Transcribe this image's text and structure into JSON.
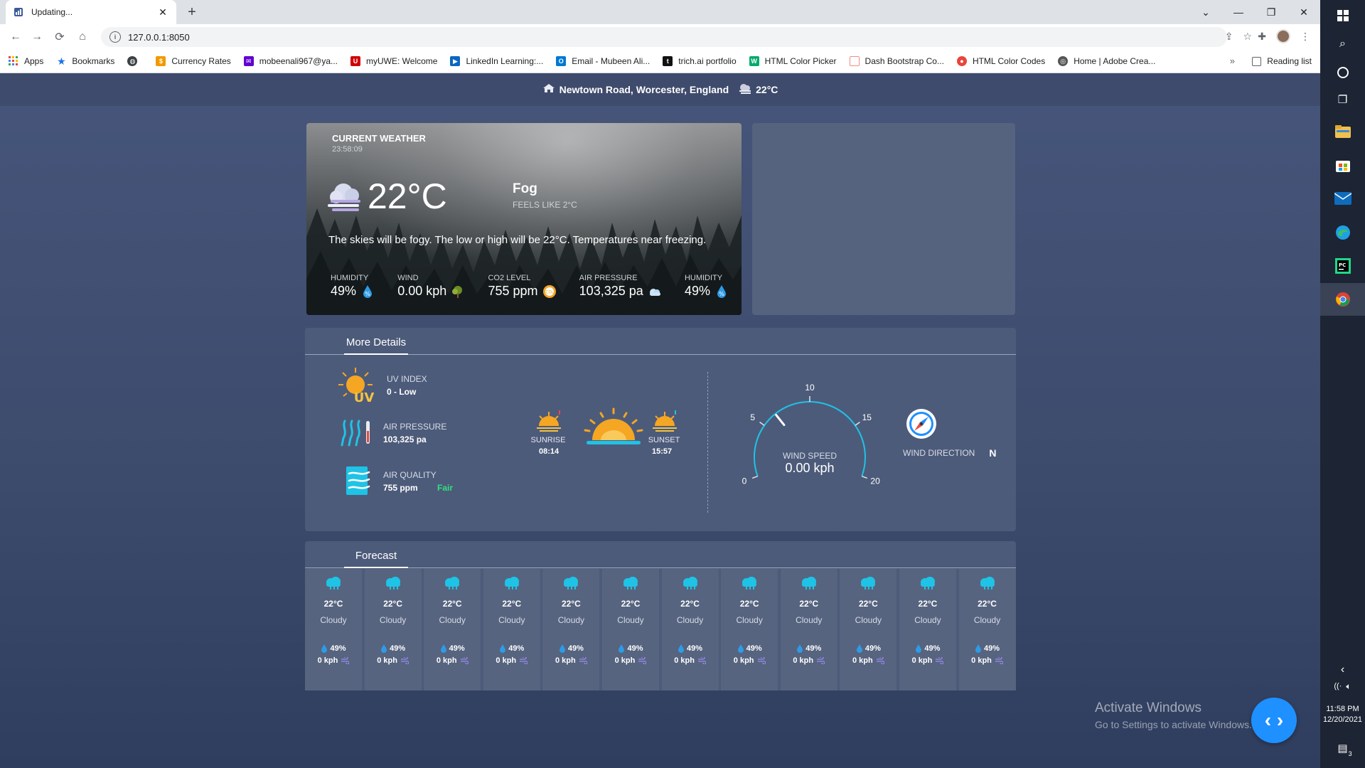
{
  "browser": {
    "tab_title": "Updating...",
    "url": "127.0.0.1:8050",
    "bookmarks": [
      {
        "label": "Apps",
        "icon": "apps-grid-icon",
        "color": "#e8453c"
      },
      {
        "label": "Bookmarks",
        "icon": "star-icon",
        "color": "#1a73e8"
      },
      {
        "label": "",
        "icon": "globe-icon",
        "color": "#3c4043"
      },
      {
        "label": "Currency Rates",
        "icon": "currency-icon",
        "color": "#f29900"
      },
      {
        "label": "mobeenali967@ya...",
        "icon": "mail-icon",
        "color": "#6001d2"
      },
      {
        "label": "myUWE: Welcome",
        "icon": "uwe-icon",
        "color": "#d00000"
      },
      {
        "label": "LinkedIn Learning:...",
        "icon": "linkedin-learning-icon",
        "color": "#0a66c2"
      },
      {
        "label": "Email - Mubeen Ali...",
        "icon": "outlook-icon",
        "color": "#0078d4"
      },
      {
        "label": "trich.ai portfolio",
        "icon": "trich-icon",
        "color": "#111111"
      },
      {
        "label": "HTML Color Picker",
        "icon": "w3-icon",
        "color": "#04aa6d"
      },
      {
        "label": "Dash Bootstrap Co...",
        "icon": "dash-icon",
        "color": "#f28b82"
      },
      {
        "label": "HTML Color Codes",
        "icon": "color-codes-icon",
        "color": "#e8453c"
      },
      {
        "label": "Home | Adobe Crea...",
        "icon": "adobe-icon",
        "color": "#555555"
      }
    ],
    "reading_list": "Reading list"
  },
  "header": {
    "location": "Newtown Road, Worcester, England",
    "temp": "22°C"
  },
  "current": {
    "label": "CURRENT WEATHER",
    "time": "23:58:09",
    "temp": "22°C",
    "condition": "Fog",
    "feels_like": "FEELS LIKE 2°C",
    "description": "The skies will be fogy. The low or high will be 22°C. Temperatures near freezing.",
    "stats": [
      {
        "label": "HUMIDITY",
        "value": "49%",
        "icon": "humidity-drop-icon"
      },
      {
        "label": "WIND",
        "value": "0.00 kph",
        "icon": "wind-tree-icon"
      },
      {
        "label": "CO2 LEVEL",
        "value": "755 ppm",
        "icon": "co2-icon"
      },
      {
        "label": "AIR PRESSURE",
        "value": "103,325 pa",
        "icon": "pressure-cloud-icon"
      },
      {
        "label": "HUMIDITY",
        "value": "49%",
        "icon": "humidity-drop-icon"
      }
    ]
  },
  "more_details": {
    "tab": "More Details",
    "uv": {
      "label": "UV INDEX",
      "value": "0 - Low"
    },
    "air_pressure": {
      "label": "AIR PRESSURE",
      "value": "103,325 pa"
    },
    "air_quality": {
      "label": "AIR QUALITY",
      "value": "755 ppm",
      "status": "Fair"
    },
    "sunrise": {
      "label": "SUNRISE",
      "time": "08:14"
    },
    "sunset": {
      "label": "SUNSET",
      "time": "15:57"
    },
    "wind_speed": {
      "label": "WIND SPEED",
      "value": "0.00 kph",
      "gauge_min": 0,
      "gauge_max": 20,
      "ticks": [
        "0",
        "5",
        "10",
        "15",
        "20"
      ],
      "needle_value": 6.5
    },
    "wind_direction": {
      "label": "WIND DIRECTION",
      "value": "N"
    }
  },
  "forecast": {
    "tab": "Forecast",
    "days": [
      {
        "temp": "22°C",
        "condition": "Cloudy",
        "humidity": "49%",
        "wind": "0 kph"
      },
      {
        "temp": "22°C",
        "condition": "Cloudy",
        "humidity": "49%",
        "wind": "0 kph"
      },
      {
        "temp": "22°C",
        "condition": "Cloudy",
        "humidity": "49%",
        "wind": "0 kph"
      },
      {
        "temp": "22°C",
        "condition": "Cloudy",
        "humidity": "49%",
        "wind": "0 kph"
      },
      {
        "temp": "22°C",
        "condition": "Cloudy",
        "humidity": "49%",
        "wind": "0 kph"
      },
      {
        "temp": "22°C",
        "condition": "Cloudy",
        "humidity": "49%",
        "wind": "0 kph"
      },
      {
        "temp": "22°C",
        "condition": "Cloudy",
        "humidity": "49%",
        "wind": "0 kph"
      },
      {
        "temp": "22°C",
        "condition": "Cloudy",
        "humidity": "49%",
        "wind": "0 kph"
      },
      {
        "temp": "22°C",
        "condition": "Cloudy",
        "humidity": "49%",
        "wind": "0 kph"
      },
      {
        "temp": "22°C",
        "condition": "Cloudy",
        "humidity": "49%",
        "wind": "0 kph"
      },
      {
        "temp": "22°C",
        "condition": "Cloudy",
        "humidity": "49%",
        "wind": "0 kph"
      },
      {
        "temp": "22°C",
        "condition": "Cloudy",
        "humidity": "49%",
        "wind": "0 kph"
      }
    ]
  },
  "windows": {
    "activate_title": "Activate Windows",
    "activate_sub": "Go to Settings to activate Windows.",
    "clock_time": "11:58 PM",
    "clock_date": "12/20/2021",
    "notification_count": "3"
  },
  "colors": {
    "page_bg": "#46557a",
    "panel_bg": "#4d5b7a",
    "accent_cyan": "#1fc3e6",
    "fab_blue": "#1e90ff",
    "fair_green": "#2ee27a"
  }
}
